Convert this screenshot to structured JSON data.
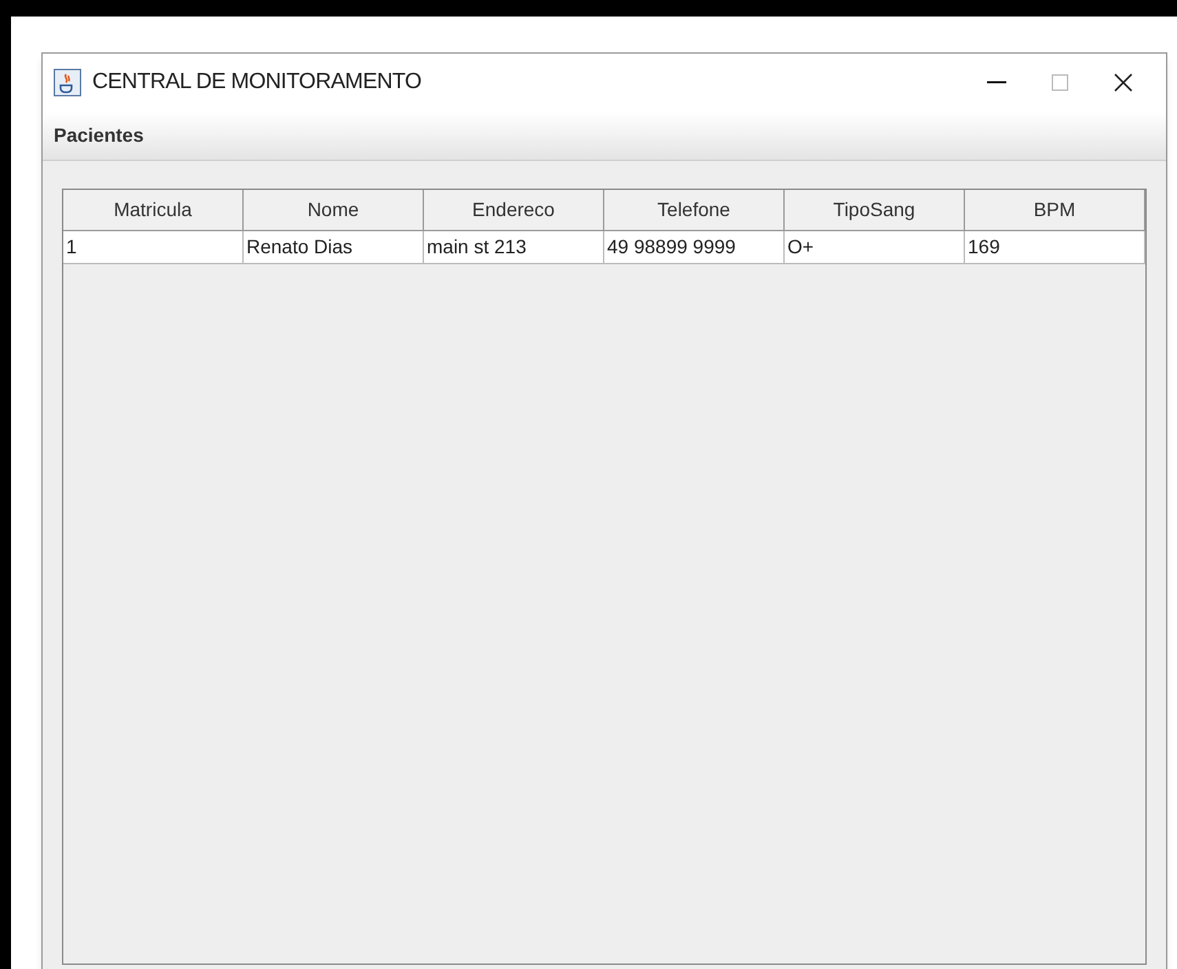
{
  "window": {
    "title": "CENTRAL DE MONITORAMENTO"
  },
  "menu": [
    {
      "label": "Pacientes"
    }
  ],
  "table": {
    "columns": [
      "Matricula",
      "Nome",
      "Endereco",
      "Telefone",
      "TipoSang",
      "BPM"
    ],
    "rows": [
      [
        "1",
        "Renato Dias",
        "main st 213",
        "49 98899 9999",
        "O+",
        "169"
      ]
    ]
  }
}
